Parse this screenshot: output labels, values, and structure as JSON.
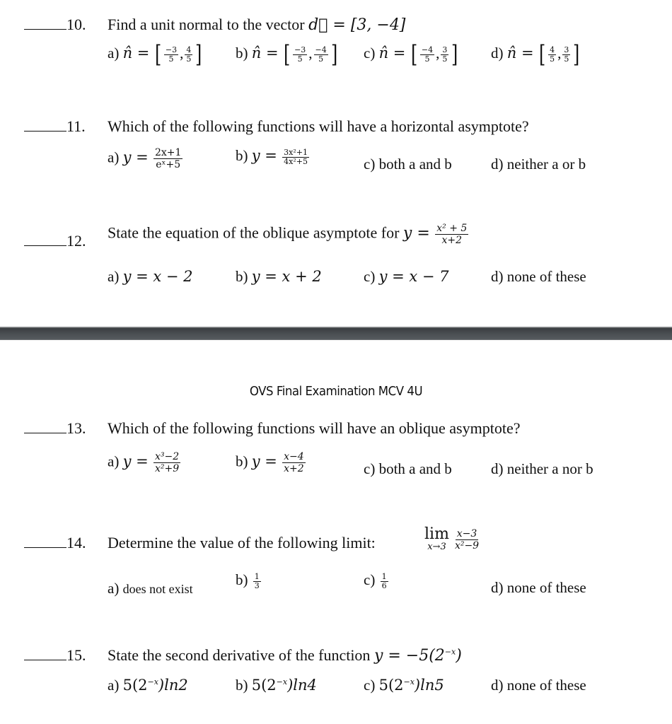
{
  "header": {
    "title": "OVS Final Examination MCV 4U"
  },
  "questions": [
    {
      "number": "10.",
      "prompt": "Find a unit normal to the vector",
      "prompt_math": "d⃗ = [3, −4]",
      "options": [
        {
          "label": "a)",
          "lhs": "n̂ =",
          "f1n": "−3",
          "f1d": "5",
          "f2n": "4",
          "f2d": "5"
        },
        {
          "label": "b)",
          "lhs": "n̂ =",
          "f1n": "−3",
          "f1d": "5",
          "f2n": "−4",
          "f2d": "5"
        },
        {
          "label": "c)",
          "lhs": "n̂ =",
          "f1n": "−4",
          "f1d": "5",
          "f2n": "3",
          "f2d": "5"
        },
        {
          "label": "d)",
          "lhs": "n̂ =",
          "f1n": "4",
          "f1d": "5",
          "f2n": "3",
          "f2d": "5"
        }
      ]
    },
    {
      "number": "11.",
      "prompt": "Which of the following functions will have a horizontal asymptote?",
      "options": [
        {
          "label": "a)",
          "lhs": "y =",
          "num": "2x+1",
          "den": "eˣ+5"
        },
        {
          "label": "b)",
          "lhs": "y =",
          "num": "3x²+1",
          "den": "4x²+5"
        },
        {
          "label": "c)",
          "text": "both a and b"
        },
        {
          "label": "d)",
          "text": "neither a or b"
        }
      ]
    },
    {
      "number": "12.",
      "prompt": "State the equation of the oblique asymptote for",
      "prompt_lhs": "y =",
      "prompt_num": "x² + 5",
      "prompt_den": "x+2",
      "options": [
        {
          "label": "a)",
          "math": "y = x − 2"
        },
        {
          "label": "b)",
          "math": "y = x + 2"
        },
        {
          "label": "c)",
          "math": "y = x − 7"
        },
        {
          "label": "d)",
          "text": "none of these"
        }
      ]
    },
    {
      "number": "13.",
      "prompt": "Which of the following functions will have an oblique asymptote?",
      "options": [
        {
          "label": "a)",
          "lhs": "y =",
          "num": "x³−2",
          "den": "x²+9"
        },
        {
          "label": "b)",
          "lhs": "y =",
          "num": "x−4",
          "den": "x+2"
        },
        {
          "label": "c)",
          "text": "both a and b"
        },
        {
          "label": "d)",
          "text": "neither a nor b"
        }
      ]
    },
    {
      "number": "14.",
      "prompt": "Determine the value of the following limit:",
      "limit_word": "lim",
      "limit_sub": "x→3",
      "limit_num": "x−3",
      "limit_den": "x²−9",
      "options": [
        {
          "label": "a)",
          "text": "does not exist"
        },
        {
          "label": "b)",
          "num": "1",
          "den": "3"
        },
        {
          "label": "c)",
          "num": "1",
          "den": "6"
        },
        {
          "label": "d)",
          "text": "none of these"
        }
      ]
    },
    {
      "number": "15.",
      "prompt": "State the second derivative of the function",
      "prompt_math": "y = −5(2",
      "prompt_exp": "−x",
      "prompt_close": ")",
      "options": [
        {
          "label": "a)",
          "base": "5(2",
          "exp": "−x",
          "tail": ")ln2"
        },
        {
          "label": "b)",
          "base": "5(2",
          "exp": "−x",
          "tail": ")ln4"
        },
        {
          "label": "c)",
          "base": "5(2",
          "exp": "−x",
          "tail": ")ln5"
        },
        {
          "label": "d)",
          "text": "none of these"
        }
      ]
    }
  ]
}
